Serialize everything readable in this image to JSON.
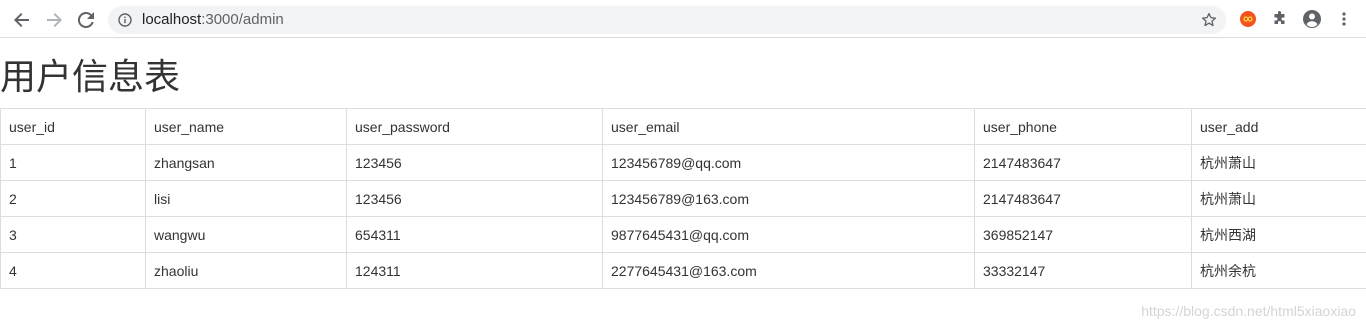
{
  "browser": {
    "url_host": "localhost",
    "url_path": ":3000/admin",
    "icons": {
      "back": "back-arrow-icon",
      "forward": "forward-arrow-icon",
      "reload": "reload-icon",
      "info": "info-icon",
      "star": "star-icon",
      "extension": "extension-icon",
      "puzzle": "puzzle-icon",
      "profile": "profile-icon",
      "menu": "kebab-menu-icon"
    }
  },
  "page": {
    "title": "用户信息表"
  },
  "table": {
    "columns": [
      "user_id",
      "user_name",
      "user_password",
      "user_email",
      "user_phone",
      "user_add"
    ],
    "rows": [
      [
        "1",
        "zhangsan",
        "123456",
        "123456789@qq.com",
        "2147483647",
        "杭州萧山"
      ],
      [
        "2",
        "lisi",
        "123456",
        "123456789@163.com",
        "2147483647",
        "杭州萧山"
      ],
      [
        "3",
        "wangwu",
        "654311",
        "9877645431@qq.com",
        "369852147",
        "杭州西湖"
      ],
      [
        "4",
        "zhaoliu",
        "124311",
        "2277645431@163.com",
        "33332147",
        "杭州余杭"
      ]
    ]
  },
  "watermark": "https://blog.csdn.net/html5xiaoxiao",
  "colors": {
    "border": "#dddddd",
    "text": "#333333",
    "omnibox": "#f1f3f4",
    "extension_accent": "#f2541b"
  }
}
